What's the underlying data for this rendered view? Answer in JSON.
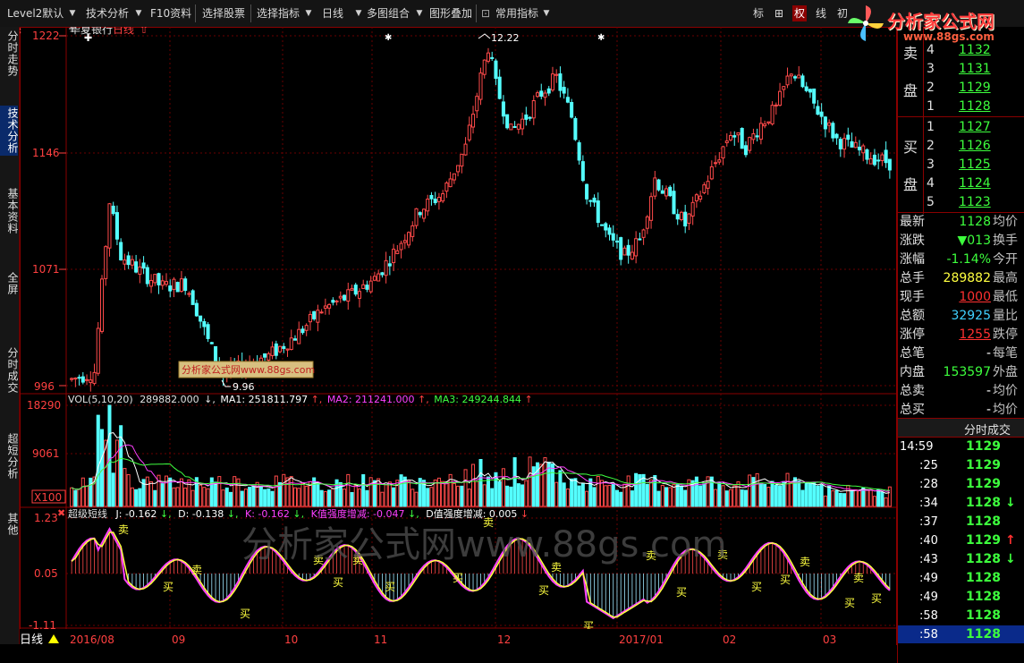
{
  "toolbar": {
    "items": [
      "Level2默认",
      "技术分析",
      "F10资料",
      "选择股票",
      "选择指标",
      "日线",
      "多图组合",
      "图形叠加",
      "常用指标"
    ],
    "right_items": [
      "标",
      "⊞",
      "权",
      "线",
      "初"
    ],
    "logo_text": "分析家公式网",
    "logo_url": "www.88gs.com"
  },
  "left_tabs": [
    "分时走势",
    "技术分析",
    "基本资料",
    "全屏",
    "分时成交",
    "超短分析",
    "其他"
  ],
  "chart": {
    "stock_name": "华夏银行",
    "period": "日线",
    "price_axis": [
      "1222",
      "1146",
      "1071",
      "996"
    ],
    "high_label": "12.22",
    "low_label": "9.96",
    "watermark_small": "分析家公式网www.88gs.com",
    "watermark_big": "分析家公式网www.88gs.com",
    "vol_header": {
      "name": "VOL(5,10,20)",
      "value": "289882.000",
      "ma1": "MA1: 251811.797",
      "ma2": "MA2: 211241.000",
      "ma3": "MA3: 249244.844"
    },
    "vol_axis": [
      "18290",
      "9061",
      "X100"
    ],
    "ind_header": {
      "name": "超级短线",
      "j": "J: -0.162",
      "d": "D: -0.138",
      "k": "K: -0.162",
      "kstr": "K值强度增减: -0.047",
      "dstr": "D值强度增减: 0.005"
    },
    "ind_axis": [
      "1.23",
      "0.05",
      "-1.11"
    ],
    "buy_label": "买",
    "sell_label": "卖",
    "x_axis": [
      "2016/08",
      "09",
      "10",
      "11",
      "12",
      "2017/01",
      "02",
      "03"
    ],
    "period_button": "日线"
  },
  "order_book": {
    "sell_label_1": "卖",
    "sell_label_2": "盘",
    "buy_label_1": "买",
    "buy_label_2": "盘",
    "sell": [
      {
        "level": "4",
        "price": "1132"
      },
      {
        "level": "3",
        "price": "1131"
      },
      {
        "level": "2",
        "price": "1129"
      },
      {
        "level": "1",
        "price": "1128"
      }
    ],
    "buy": [
      {
        "level": "1",
        "price": "1127"
      },
      {
        "level": "2",
        "price": "1126"
      },
      {
        "level": "3",
        "price": "1125"
      },
      {
        "level": "4",
        "price": "1124"
      },
      {
        "level": "5",
        "price": "1123"
      }
    ]
  },
  "quote": [
    {
      "label": "最新",
      "value": "1128",
      "cls": "green",
      "cut": "均价"
    },
    {
      "label": "涨跌",
      "value": "▼013",
      "cls": "green",
      "cut": "换手"
    },
    {
      "label": "涨幅",
      "value": "-1.14%",
      "cls": "green",
      "cut": "今开"
    },
    {
      "label": "总手",
      "value": "289882",
      "cls": "yellow",
      "cut": "最高"
    },
    {
      "label": "现手",
      "value": "1000",
      "cls": "red",
      "cut": "最低"
    },
    {
      "label": "总额",
      "value": "32925",
      "cls": "cyan",
      "cut": "量比"
    },
    {
      "label": "涨停",
      "value": "1255",
      "cls": "red",
      "cut": "跌停"
    },
    {
      "label": "总笔",
      "value": "-",
      "cls": "white",
      "cut": "每笔"
    },
    {
      "label": "内盘",
      "value": "153597",
      "cls": "green",
      "cut": "外盘"
    },
    {
      "label": "总卖",
      "value": "-",
      "cls": "white",
      "cut": "均价"
    },
    {
      "label": "总买",
      "value": "-",
      "cls": "white",
      "cut": "均价"
    }
  ],
  "ticks": {
    "title": "分时成交",
    "rows": [
      {
        "time": "14:59",
        "price": "1129",
        "arrow": ""
      },
      {
        "time": ":25",
        "price": "1129",
        "arrow": ""
      },
      {
        "time": ":28",
        "price": "1129",
        "arrow": ""
      },
      {
        "time": ":34",
        "price": "1128",
        "arrow": "↓"
      },
      {
        "time": ":37",
        "price": "1128",
        "arrow": ""
      },
      {
        "time": ":40",
        "price": "1129",
        "arrow": "↑"
      },
      {
        "time": ":43",
        "price": "1128",
        "arrow": "↓"
      },
      {
        "time": ":49",
        "price": "1128",
        "arrow": ""
      },
      {
        "time": ":49",
        "price": "1128",
        "arrow": ""
      },
      {
        "time": ":58",
        "price": "1128",
        "arrow": ""
      },
      {
        "time": ":58",
        "price": "1128",
        "arrow": ""
      }
    ]
  },
  "colors": {
    "up": "#ff4a4a",
    "down": "#54ffff",
    "ma1": "#ffffff",
    "ma2": "#ff40ff",
    "ma3": "#40ff40",
    "kline_yellow": "#ffff40",
    "kline_magenta": "#ff40ff",
    "grid": "#8a0000"
  }
}
